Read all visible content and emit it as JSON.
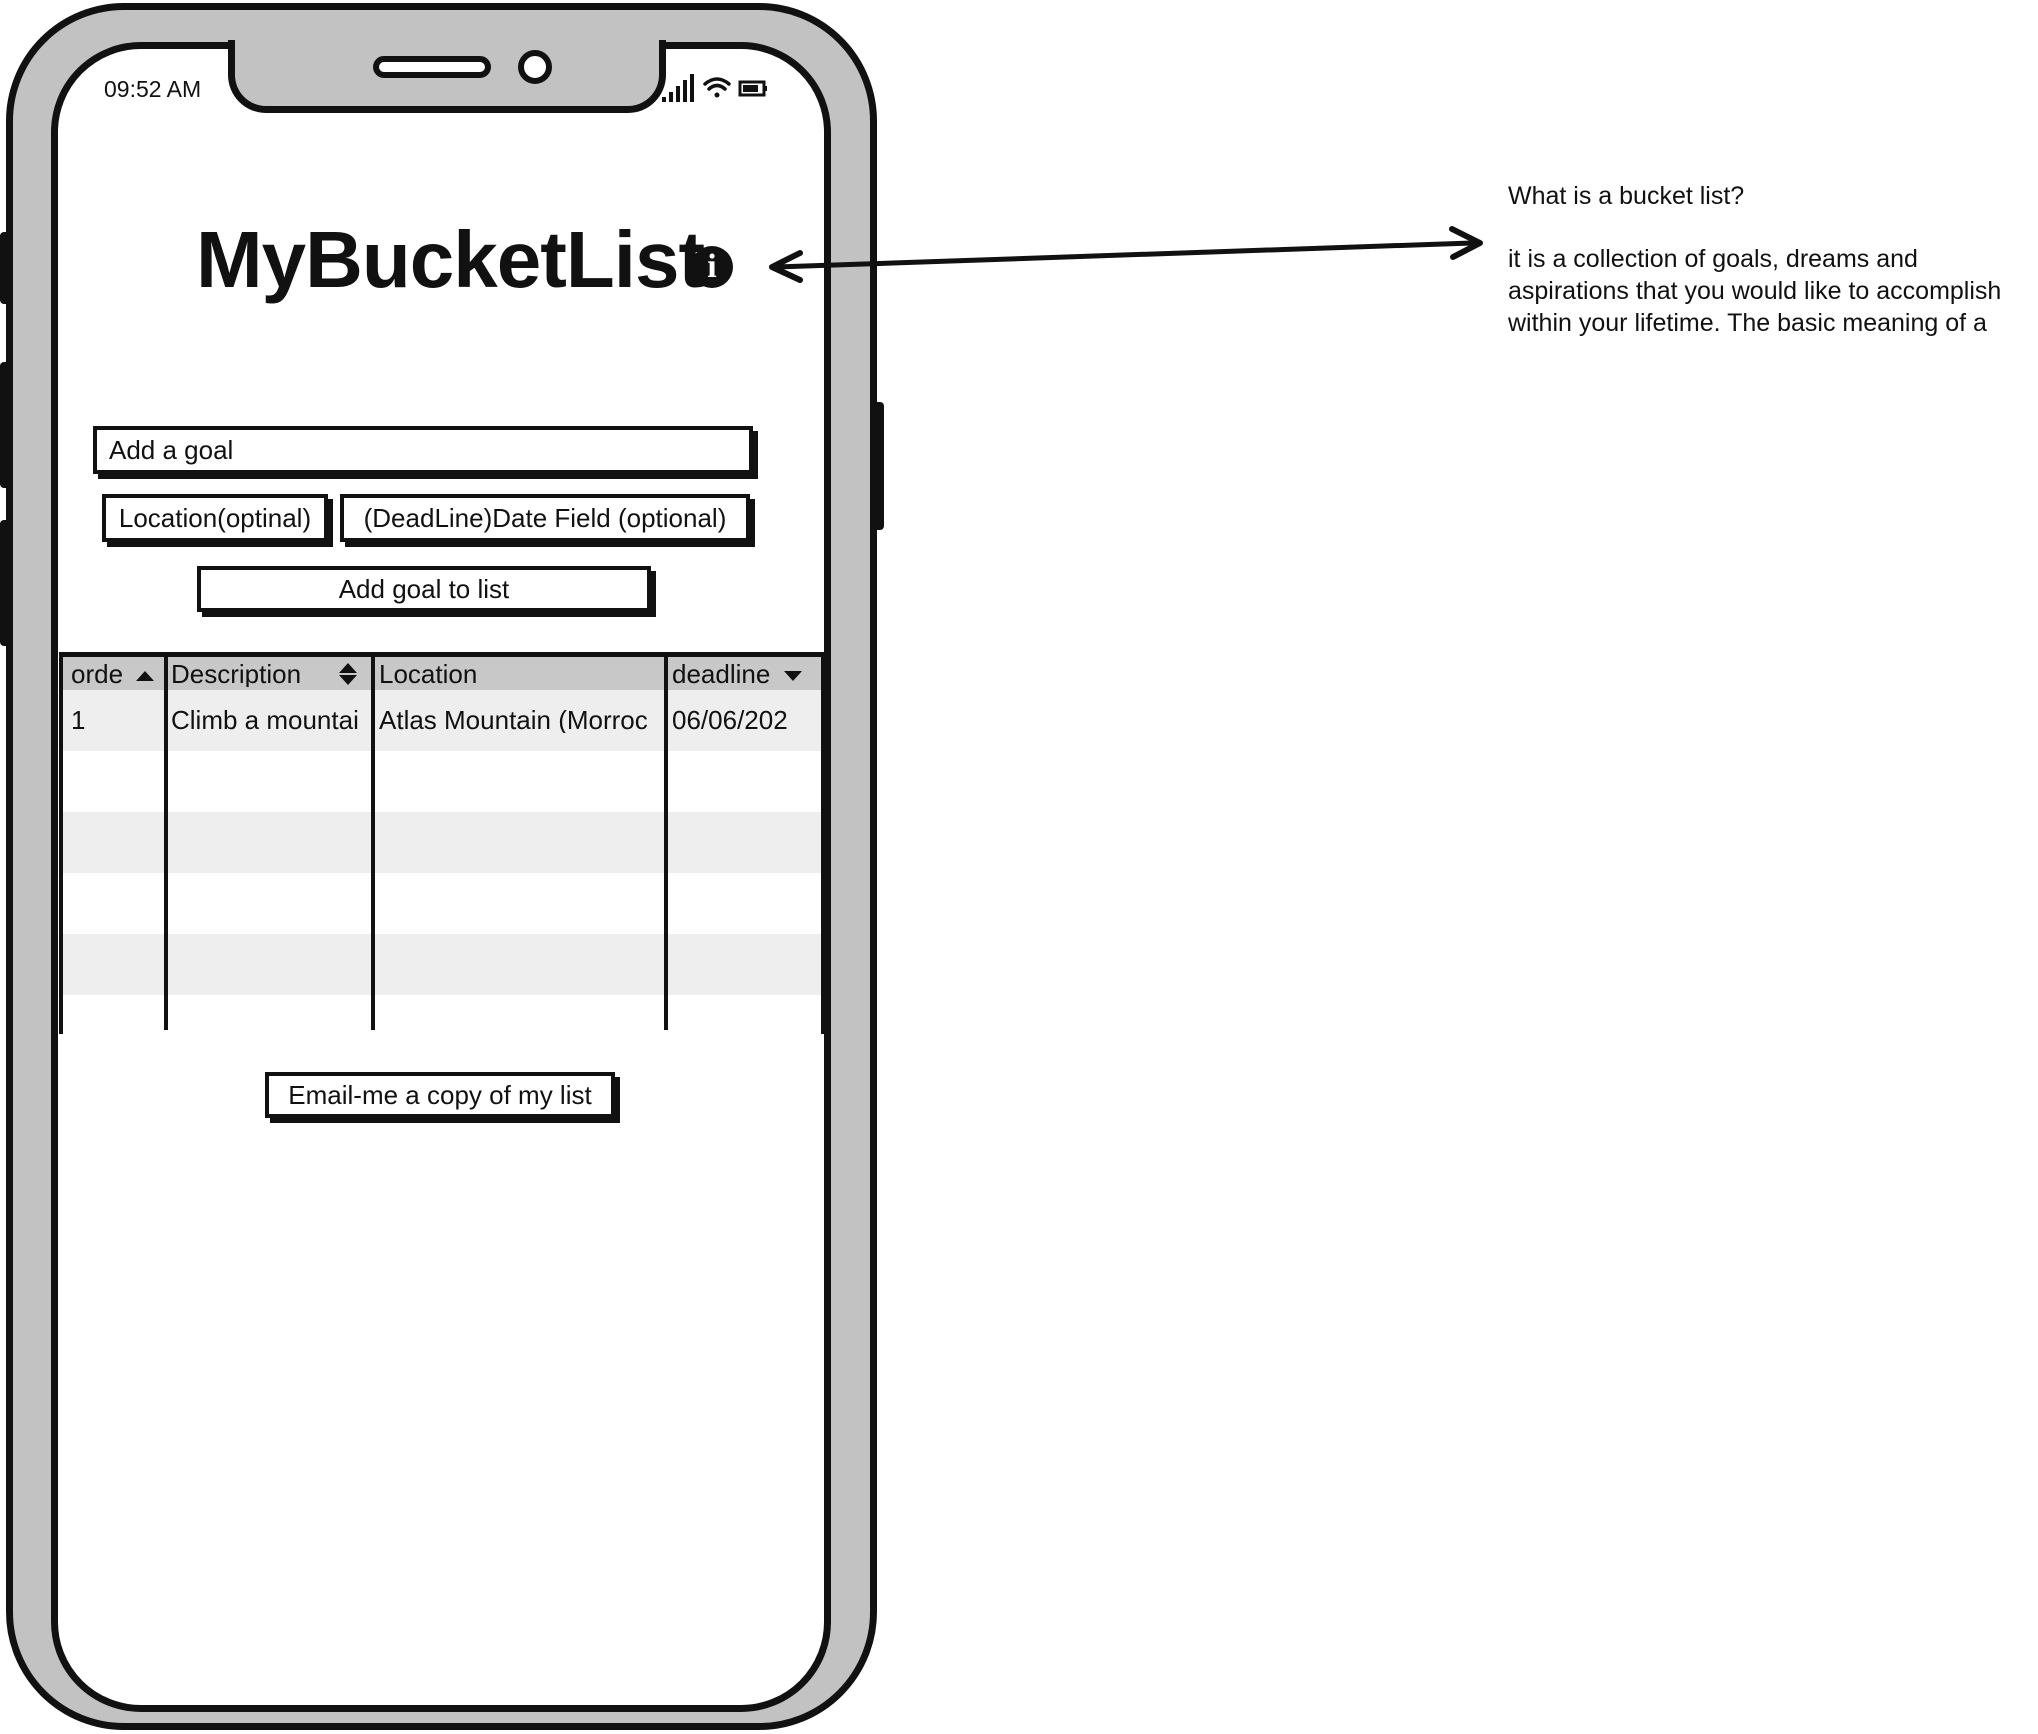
{
  "status_bar": {
    "time": "09:52 AM",
    "icons": [
      "signal-icon",
      "wifi-icon",
      "battery-icon"
    ]
  },
  "app": {
    "title": "MyBucketList",
    "info_icon": "info-icon"
  },
  "form": {
    "goal_placeholder": "Add a goal",
    "location_label": "Location(optinal)",
    "deadline_label": "(DeadLine)Date Field (optional)",
    "add_button": "Add goal to list"
  },
  "table": {
    "columns": [
      {
        "label": "orde",
        "sort": "asc"
      },
      {
        "label": "Description",
        "sort": "both"
      },
      {
        "label": "Location",
        "sort": "none"
      },
      {
        "label": "deadline",
        "sort": "desc"
      }
    ],
    "rows": [
      {
        "order": "1",
        "description": "Climb a mountai",
        "location": "Atlas Mountain (Morroc",
        "deadline": "06/06/202"
      }
    ]
  },
  "email_button": "Email-me a copy of my list",
  "annotation": {
    "heading": "What is a bucket list?",
    "line1": "it is a collection of goals, dreams and",
    "line2": "aspirations that you would like to accomplish",
    "line3": "within your lifetime. The basic meaning of a"
  },
  "colors": {
    "frame": "#c2c2c2",
    "ink": "#111111",
    "header_row": "#c8c8c8",
    "stripe_row": "#eeeeee"
  }
}
